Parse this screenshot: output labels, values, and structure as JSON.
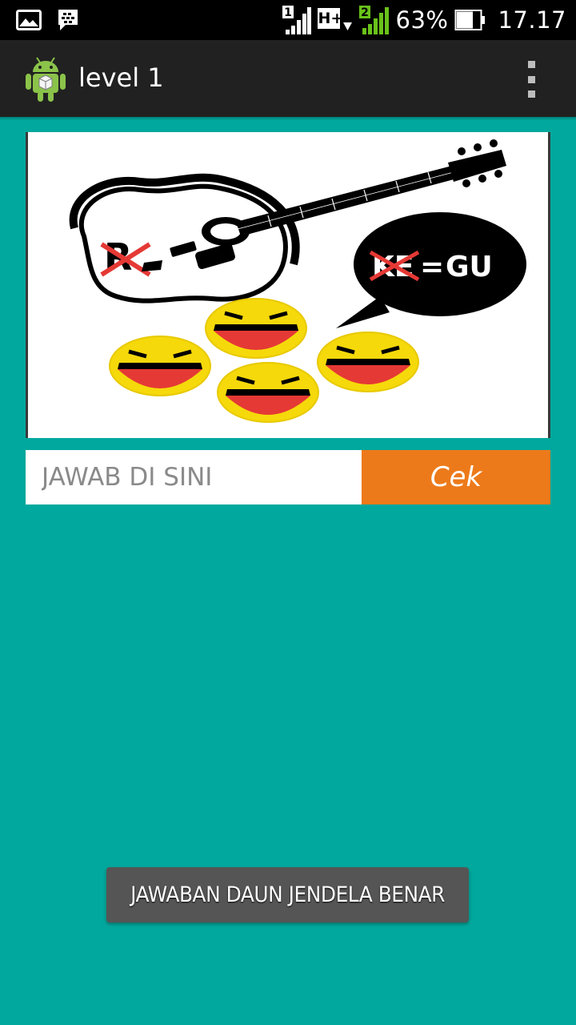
{
  "status_bar": {
    "battery_percent": "63%",
    "time": "17.17",
    "network_type": "H+",
    "sim1_label": "1",
    "sim2_label": "2",
    "icons": [
      "gallery-icon",
      "bbm-icon",
      "signal-sim1-icon",
      "network-hplus-icon",
      "signal-sim2-icon",
      "battery-icon"
    ]
  },
  "action_bar": {
    "title": "level 1",
    "logo_icon": "android-robot-icon",
    "menu_icon": "overflow-menu-icon"
  },
  "puzzle": {
    "image_icon": "guitar-riddle-image",
    "overlay_text": "GU",
    "crossed_text_1": "R",
    "crossed_text_2": "KE",
    "equals_sign": "="
  },
  "answer": {
    "placeholder": "JAWAB DI SINI",
    "value": "",
    "check_label": "Cek"
  },
  "toast": {
    "message": "JAWABAN DAUN JENDELA BENAR"
  },
  "colors": {
    "background": "#00a89d",
    "action_bar": "#212121",
    "check_button": "#ed7a1a",
    "toast": "#555555"
  }
}
